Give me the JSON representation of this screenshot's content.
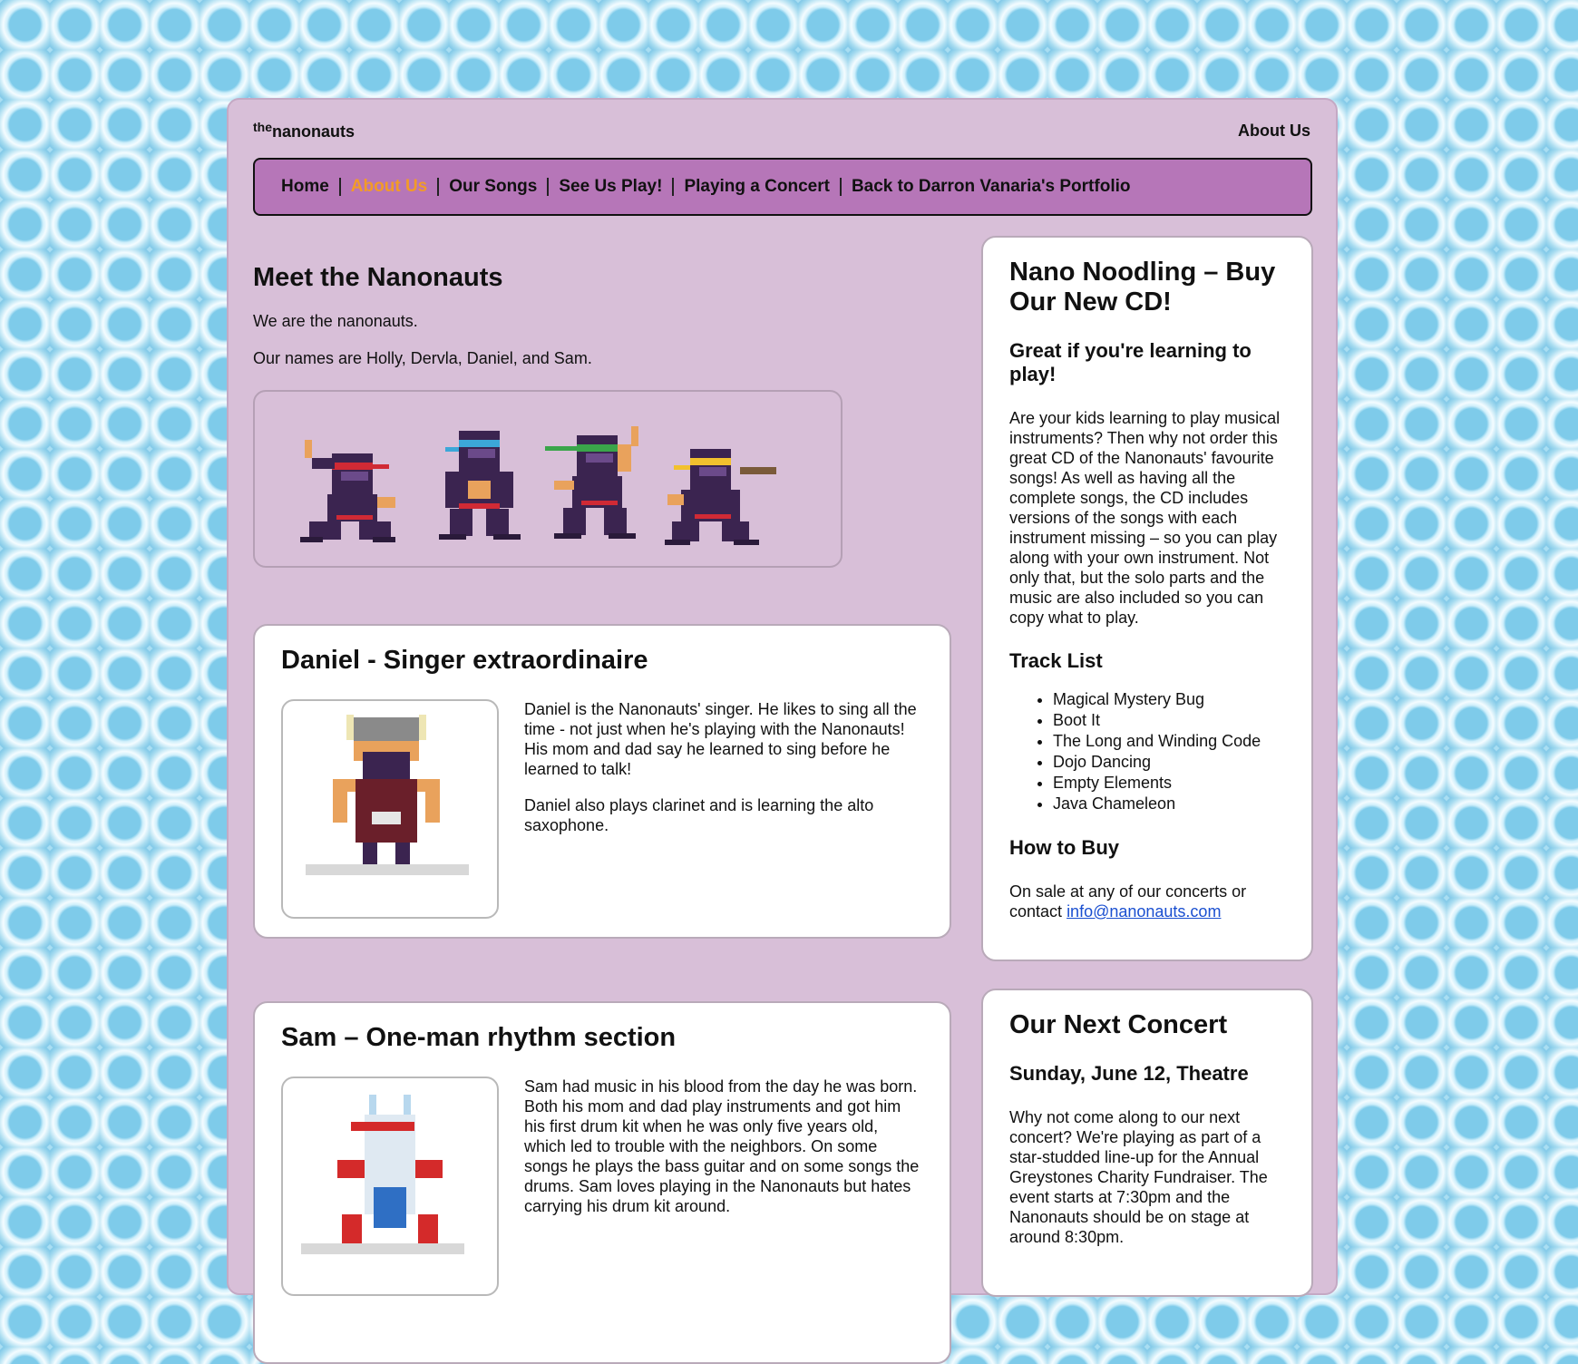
{
  "header": {
    "brand_small": "the",
    "brand_main": "nanonauts",
    "current_section": "About Us"
  },
  "nav": {
    "items": [
      {
        "label": "Home",
        "active": false
      },
      {
        "label": "About Us",
        "active": true
      },
      {
        "label": "Our Songs",
        "active": false
      },
      {
        "label": "See Us Play!",
        "active": false
      },
      {
        "label": "Playing a Concert",
        "active": false
      },
      {
        "label": "Back to Darron Vanaria's Portfolio",
        "active": false
      }
    ]
  },
  "main": {
    "title": "Meet the Nanonauts",
    "intro": "We are the nanonauts.",
    "names": "Our names are Holly, Dervla, Daniel, and Sam.",
    "members": [
      {
        "heading": "Daniel - Singer extraordinaire",
        "paragraphs": [
          "Daniel is the Nanonauts' singer. He likes to sing all the time - not just when he's playing with the Nanonauts! His mom and dad say he learned to sing before he learned to talk!",
          "Daniel also plays clarinet and is learning the alto saxophone."
        ]
      },
      {
        "heading": "Sam – One-man rhythm section",
        "paragraphs": [
          "Sam had music in his blood from the day he was born. Both his mom and dad play instruments and got him his first drum kit when he was only five years old, which led to trouble with the neighbors. On some songs he plays the bass guitar and on some songs the drums. Sam loves playing in the Nanonauts but hates carrying his drum kit around."
        ]
      }
    ]
  },
  "sidebar": {
    "cd": {
      "title": "Nano Noodling – Buy Our New CD!",
      "subtitle": "Great if you're learning to play!",
      "description": "Are your kids learning to play musical instruments? Then why not order this great CD of the Nanonauts' favourite songs! As well as having all the complete songs, the CD includes versions of the songs with each instrument missing – so you can play along with your own instrument. Not only that, but the solo parts and the music are also included so you can copy what to play.",
      "track_heading": "Track List",
      "tracks": [
        "Magical Mystery Bug",
        "Boot It",
        "The Long and Winding Code",
        "Dojo Dancing",
        "Empty Elements",
        "Java Chameleon"
      ],
      "buy_heading": "How to Buy",
      "buy_text": "On sale at any of our concerts or contact",
      "email": "info@nanonauts.com"
    },
    "concert": {
      "title": "Our Next Concert",
      "date": "Sunday, June 12, Theatre",
      "description": "Why not come along to our next concert? We're playing as part of a star-studded line-up for the Annual Greystones Charity Fundraiser. The event starts at 7:30pm and the Nanonauts should be on stage at around 8:30pm."
    }
  },
  "colors": {
    "page_bg": "#d8bfd8",
    "nav_bg": "#b676b8",
    "nav_active": "#f29b28",
    "link": "#1a4fd0"
  }
}
